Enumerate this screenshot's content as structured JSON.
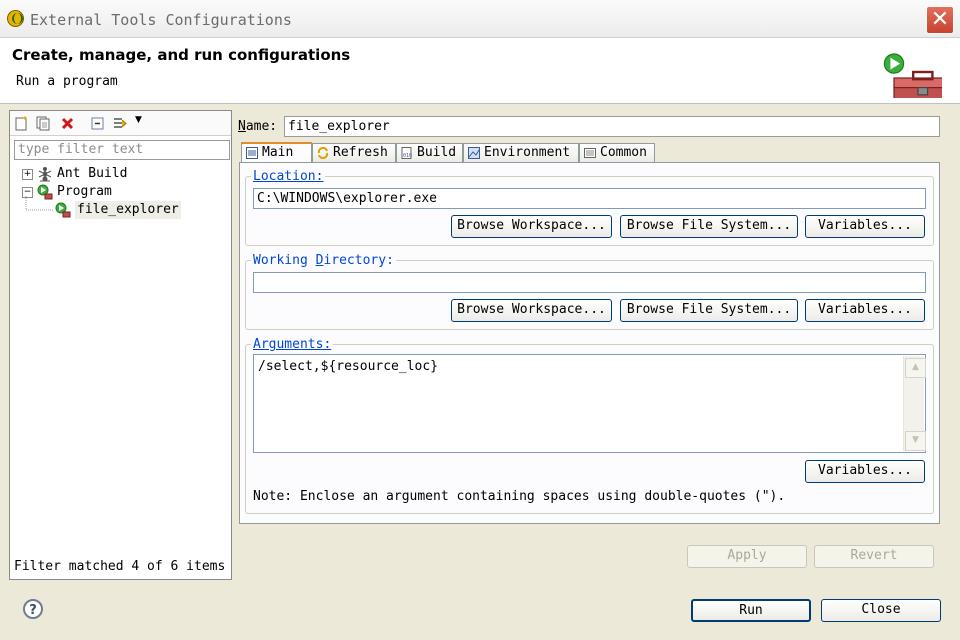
{
  "window": {
    "title": "External Tools Configurations",
    "close_glyph": "✕"
  },
  "header": {
    "title": "Create, manage, and run configurations",
    "subtitle": "Run a program",
    "icon": "toolbox-run-icon"
  },
  "left": {
    "toolbar_icons": [
      "new-config-icon",
      "duplicate-icon",
      "delete-icon",
      "collapse-all-icon",
      "filter-icon",
      "dropdown-arrow-icon"
    ],
    "filter_placeholder": "type filter text",
    "tree": [
      {
        "label": "Ant Build",
        "expanded": false,
        "icon": "ant-icon"
      },
      {
        "label": "Program",
        "expanded": true,
        "icon": "program-run-icon",
        "children": [
          {
            "label": "file_explorer",
            "selected": true,
            "icon": "program-config-icon"
          }
        ]
      }
    ],
    "status": "Filter matched 4 of 6 items"
  },
  "name": {
    "label_prefix": "N",
    "label_rest": "ame:",
    "value": "file_explorer"
  },
  "tabs": [
    {
      "label": "Main",
      "active": true
    },
    {
      "label": "Refresh",
      "active": false
    },
    {
      "label": "Build",
      "active": false
    },
    {
      "label": "Environment",
      "active": false
    },
    {
      "label": "Common",
      "active": false
    }
  ],
  "location": {
    "label": "Location:",
    "value": "C:\\WINDOWS\\explorer.exe"
  },
  "working_directory": {
    "label_a": "Working ",
    "label_b": "D",
    "label_c": "irectory:",
    "value": ""
  },
  "buttons": {
    "browse_workspace": "Browse Workspace...",
    "browse_file_system": "Browse File System...",
    "variables": "Variables..."
  },
  "arguments": {
    "label": "Arguments:",
    "value": "/select,${resource_loc}"
  },
  "note": "Note: Enclose an argument containing spaces using double-quotes (\").",
  "actions": {
    "apply": "Apply",
    "revert": "Revert",
    "run": "Run",
    "close": "Close"
  },
  "colors": {
    "group_label": "#0046d5",
    "active_tab_accent": "#e68b2c",
    "button_border": "#003c74"
  }
}
